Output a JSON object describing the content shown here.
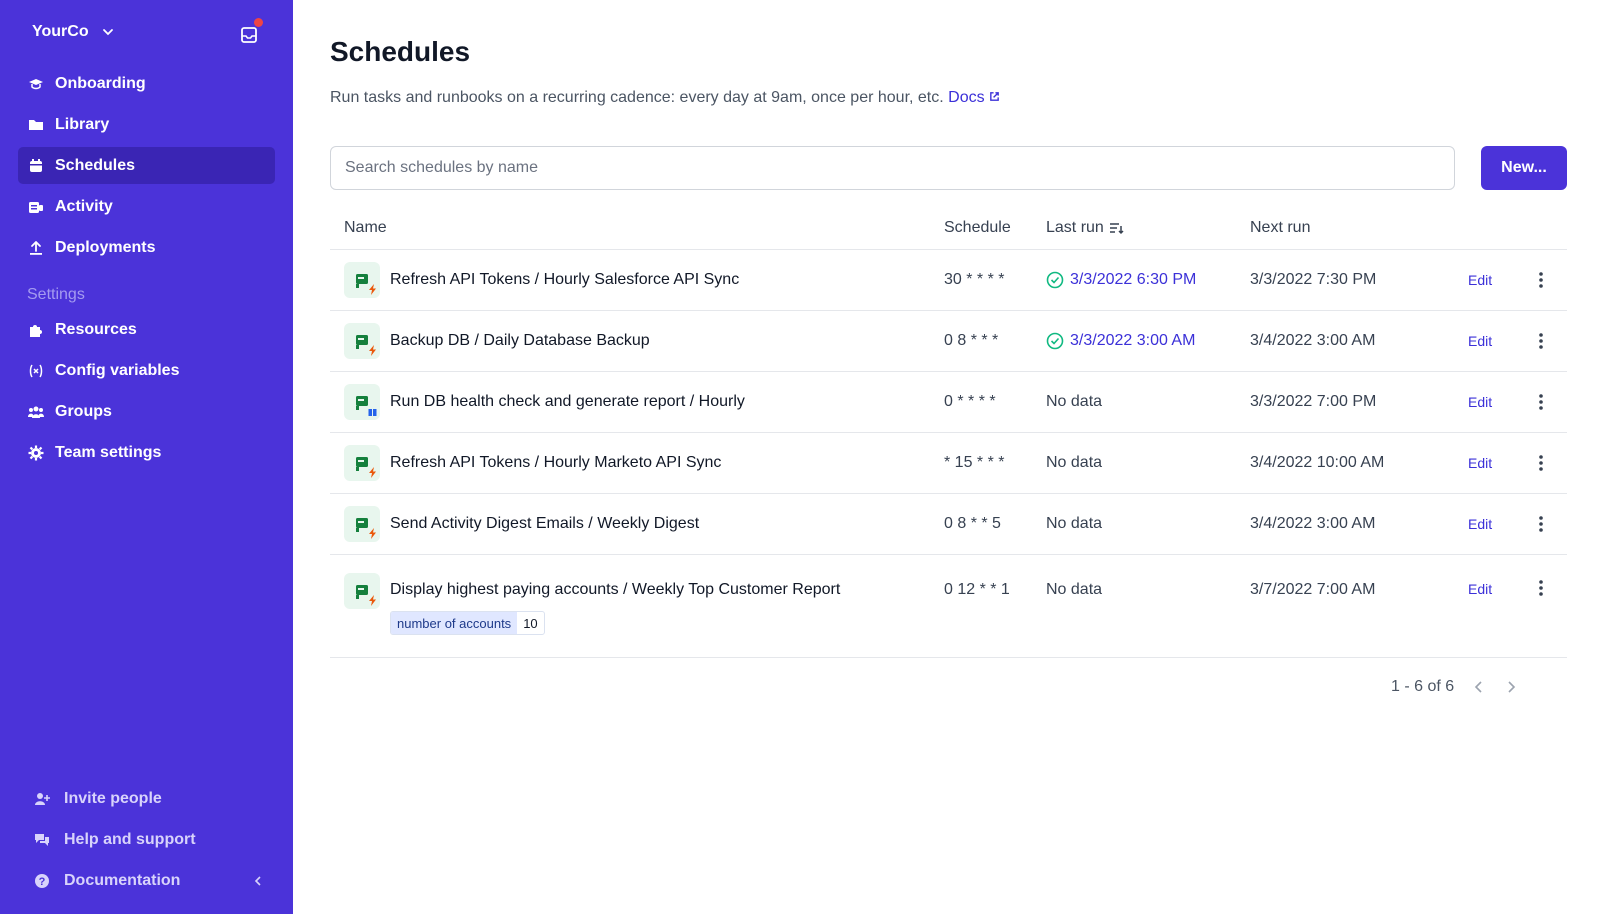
{
  "sidebar": {
    "org_name": "YourCo",
    "nav": [
      {
        "label": "Onboarding",
        "icon": "graduation-cap-icon"
      },
      {
        "label": "Library",
        "icon": "folder-icon"
      },
      {
        "label": "Schedules",
        "icon": "calendar-icon",
        "active": true
      },
      {
        "label": "Activity",
        "icon": "activity-icon"
      },
      {
        "label": "Deployments",
        "icon": "upload-icon"
      }
    ],
    "settings_label": "Settings",
    "settings_nav": [
      {
        "label": "Resources",
        "icon": "puzzle-icon"
      },
      {
        "label": "Config variables",
        "icon": "variable-icon"
      },
      {
        "label": "Groups",
        "icon": "users-icon"
      },
      {
        "label": "Team settings",
        "icon": "gear-icon"
      }
    ],
    "footer": [
      {
        "label": "Invite people",
        "icon": "user-plus-icon"
      },
      {
        "label": "Help and support",
        "icon": "chat-icon"
      },
      {
        "label": "Documentation",
        "icon": "question-icon"
      }
    ]
  },
  "page": {
    "title": "Schedules",
    "subtitle": "Run tasks and runbooks on a recurring cadence: every day at 9am, once per hour, etc.",
    "docs_link": "Docs",
    "search_placeholder": "Search schedules by name",
    "new_button": "New..."
  },
  "table": {
    "headers": {
      "name": "Name",
      "schedule": "Schedule",
      "last_run": "Last run",
      "next_run": "Next run"
    },
    "edit_label": "Edit",
    "rows": [
      {
        "name": "Refresh API Tokens / Hourly Salesforce API Sync",
        "schedule": "30 * * * *",
        "last_run": "3/3/2022 6:30 PM",
        "last_ok": true,
        "next_run": "3/3/2022 7:30 PM",
        "badge": "bolt"
      },
      {
        "name": "Backup DB / Daily Database Backup",
        "schedule": "0 8 * * *",
        "last_run": "3/3/2022 3:00 AM",
        "last_ok": true,
        "next_run": "3/4/2022 3:00 AM",
        "badge": "bolt"
      },
      {
        "name": "Run DB health check and generate report / Hourly",
        "schedule": "0 * * * *",
        "last_run": "No data",
        "last_ok": false,
        "next_run": "3/3/2022 7:00 PM",
        "badge": "runbook"
      },
      {
        "name": "Refresh API Tokens / Hourly Marketo API Sync",
        "schedule": "* 15 * * *",
        "last_run": "No data",
        "last_ok": false,
        "next_run": "3/4/2022 10:00 AM",
        "badge": "bolt"
      },
      {
        "name": "Send Activity Digest Emails / Weekly Digest",
        "schedule": "0 8 * * 5",
        "last_run": "No data",
        "last_ok": false,
        "next_run": "3/4/2022 3:00 AM",
        "badge": "bolt"
      },
      {
        "name": "Display highest paying accounts / Weekly Top Customer Report",
        "schedule": "0 12 * * 1",
        "last_run": "No data",
        "last_ok": false,
        "next_run": "3/7/2022 7:00 AM",
        "badge": "bolt",
        "param": {
          "key": "number of accounts",
          "value": "10"
        }
      }
    ]
  },
  "pagination": {
    "text": "1 - 6 of 6"
  },
  "colors": {
    "sidebar": "#4b33d9",
    "sidebar_active": "#3a25b4",
    "accent": "#3b30d8",
    "success": "#10b981"
  }
}
